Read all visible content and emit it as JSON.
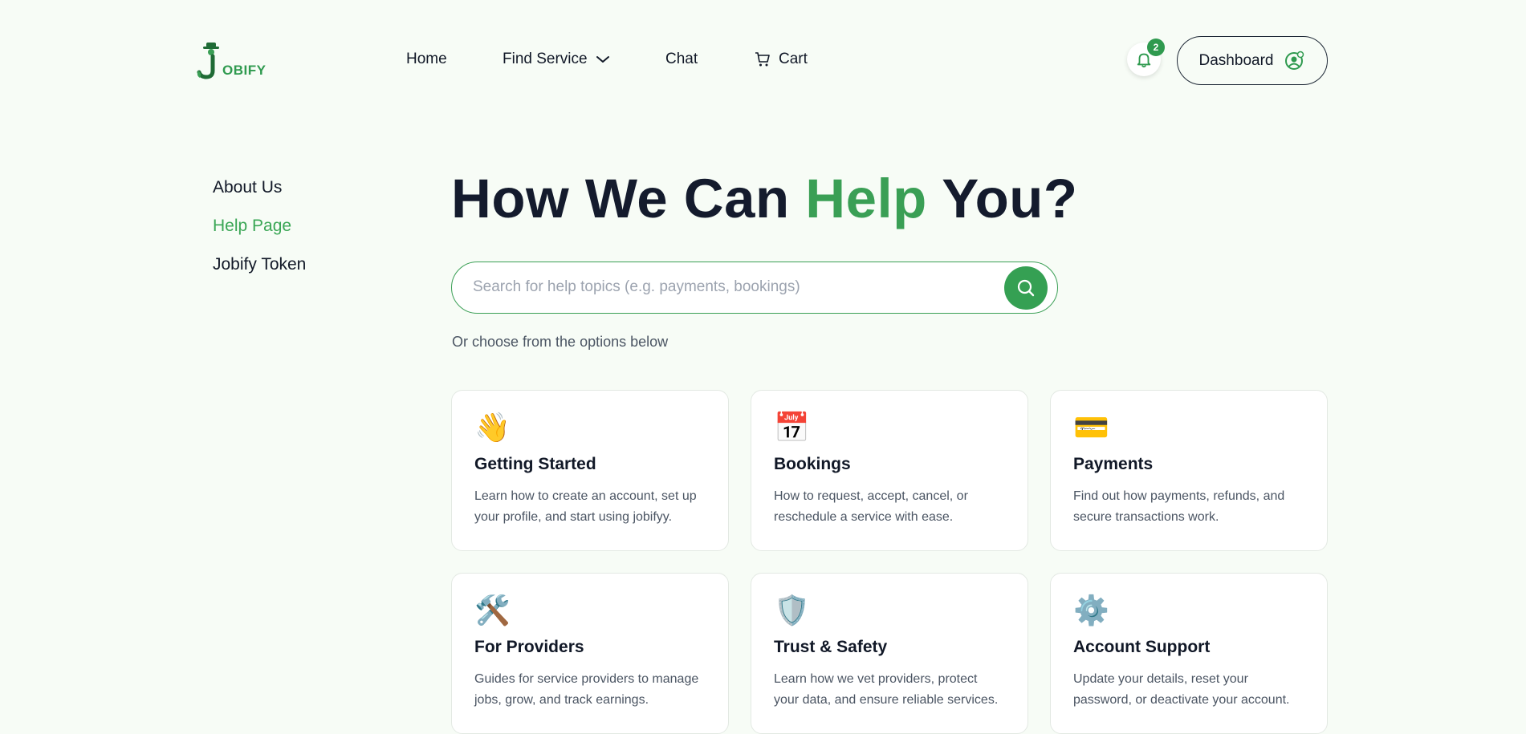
{
  "header": {
    "logo_text": "OBIFY",
    "nav": {
      "home": "Home",
      "find_service": "Find Service",
      "chat": "Chat",
      "cart": "Cart"
    },
    "notification_count": "2",
    "dashboard_label": "Dashboard"
  },
  "sidebar": {
    "items": [
      {
        "label": "About Us",
        "active": false
      },
      {
        "label": "Help Page",
        "active": true
      },
      {
        "label": "Jobify Token",
        "active": false
      }
    ]
  },
  "hero": {
    "title_part1": "How We Can ",
    "title_accent": "Help",
    "title_part2": " You?"
  },
  "search": {
    "placeholder": "Search for help topics (e.g. payments, bookings)",
    "value": ""
  },
  "hint": "Or choose from the options below",
  "cards": [
    {
      "icon": "👋",
      "icon_name": "waving-hand-icon",
      "title": "Getting Started",
      "desc": "Learn how to create an account, set up your profile, and start using jobifyy."
    },
    {
      "icon": "📅",
      "icon_name": "calendar-icon",
      "title": "Bookings",
      "desc": "How to request, accept, cancel, or reschedule a service with ease."
    },
    {
      "icon": "💳",
      "icon_name": "credit-card-icon",
      "title": "Payments",
      "desc": "Find out how payments, refunds, and secure transactions work."
    },
    {
      "icon": "🛠️",
      "icon_name": "tools-icon",
      "title": "For Providers",
      "desc": "Guides for service providers to manage jobs, grow, and track earnings."
    },
    {
      "icon": "🛡️",
      "icon_name": "shield-icon",
      "title": "Trust & Safety",
      "desc": "Learn how we vet providers, protect your data, and ensure reliable services."
    },
    {
      "icon": "⚙️",
      "icon_name": "gear-icon",
      "title": "Account Support",
      "desc": "Update your details, reset your password, or deactivate your account."
    }
  ],
  "colors": {
    "accent": "#3a9f55",
    "background": "#f7fcf6",
    "text": "#111827"
  }
}
